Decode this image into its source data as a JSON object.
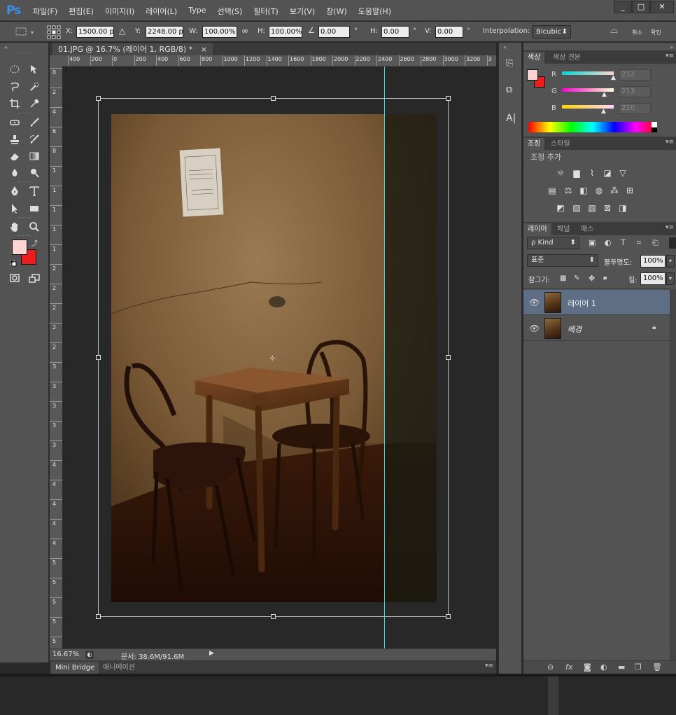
{
  "app": {
    "logo": "Ps"
  },
  "menu": [
    "파일(F)",
    "편집(E)",
    "이미지(I)",
    "레이어(L)",
    "Type",
    "선택(S)",
    "필터(T)",
    "보기(V)",
    "창(W)",
    "도움말(H)"
  ],
  "window_controls": {
    "minimize": "_",
    "maximize": "□",
    "close": "✕"
  },
  "options": {
    "x_label": "X:",
    "x_value": "1500.00 px",
    "y_label": "Y:",
    "y_value": "2248.00 px",
    "w_label": "W:",
    "w_value": "100.00%",
    "h_label": "H:",
    "h_value": "100.00%",
    "rotate_value": "0.00",
    "degree": "°",
    "hskew_label": "H:",
    "hskew_value": "0.00",
    "vskew_label": "V:",
    "vskew_value": "0.00",
    "interpolation_label": "Interpolation:",
    "interpolation_value": "Bicubic",
    "cancel_label": "취소",
    "commit_label": "확인"
  },
  "document": {
    "tab_title": "01.JPG @ 16.7% (레이어 1, RGB/8) *",
    "tab_close": "×",
    "zoom": "16.67%",
    "doc_info": "문서: 38.6M/91.6M",
    "ruler_top": [
      "400",
      "200",
      "0",
      "200",
      "400",
      "600",
      "800",
      "1000",
      "1200",
      "1400",
      "1600",
      "1800",
      "2000",
      "2200",
      "2400",
      "2600",
      "2800",
      "3000",
      "3200",
      "3"
    ],
    "ruler_left": [
      "0",
      "2",
      "4",
      "6",
      "8",
      "1",
      "1",
      "1",
      "1",
      "1",
      "2",
      "2",
      "2",
      "2",
      "2",
      "3",
      "3",
      "3",
      "3",
      "3",
      "4",
      "4",
      "4",
      "4",
      "4",
      "5",
      "5",
      "5",
      "5",
      "5"
    ]
  },
  "bottom_tabs": [
    "Mini Bridge",
    "애니메이션"
  ],
  "color_panel": {
    "tabs": [
      "색상",
      "색상 견본"
    ],
    "r_label": "R",
    "r_value": "252",
    "g_label": "G",
    "g_value": "213",
    "b_label": "B",
    "b_value": "210",
    "fg_color": "#fcd5d2",
    "bg_color": "#ee1c1c"
  },
  "adjust_panel": {
    "tabs": [
      "조정",
      "스타일"
    ],
    "title": "조정 추가"
  },
  "layers_panel": {
    "tabs": [
      "레이어",
      "채널",
      "패스"
    ],
    "filter_kind": "ρ Kind",
    "blend_mode": "표준",
    "opacity_label": "불투명도:",
    "opacity_value": "100%",
    "lock_label": "잠그기:",
    "fill_label": "칠:",
    "fill_value": "100%",
    "layers": [
      {
        "name": "레이어 1"
      },
      {
        "name": "배경"
      }
    ]
  },
  "accent": {
    "guide": "#3fd9e6",
    "ps_blue": "#3d8ee8"
  }
}
